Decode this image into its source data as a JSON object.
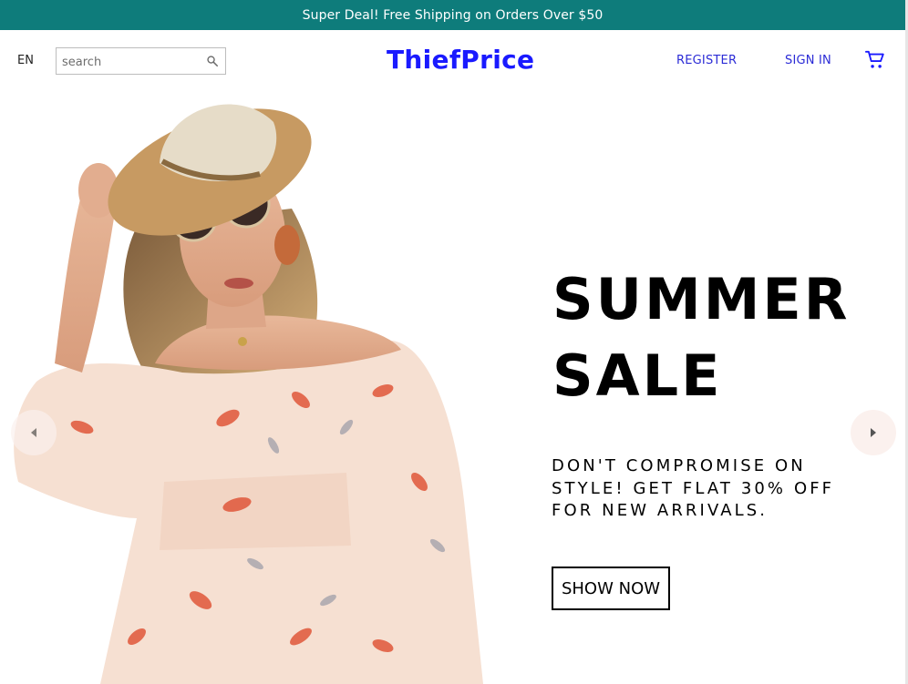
{
  "announcement": {
    "text": "Super Deal! Free Shipping on Orders Over $50",
    "background": "#0e7c7b"
  },
  "navbar": {
    "language": "EN",
    "search": {
      "placeholder": "search",
      "value": ""
    },
    "logo": "ThiefPrice",
    "register_label": "REGISTER",
    "signin_label": "SIGN IN",
    "cart_icon": "shopping-cart-icon",
    "accent_color": "#1a1aff"
  },
  "hero": {
    "title": "SUMMER SALE",
    "description": "DON'T COMPROMISE ON STYLE! GET FLAT 30% OFF FOR NEW ARRIVALS.",
    "button_label": "SHOW NOW",
    "left_arrow_icon": "arrow-left-icon",
    "right_arrow_icon": "arrow-right-icon"
  }
}
